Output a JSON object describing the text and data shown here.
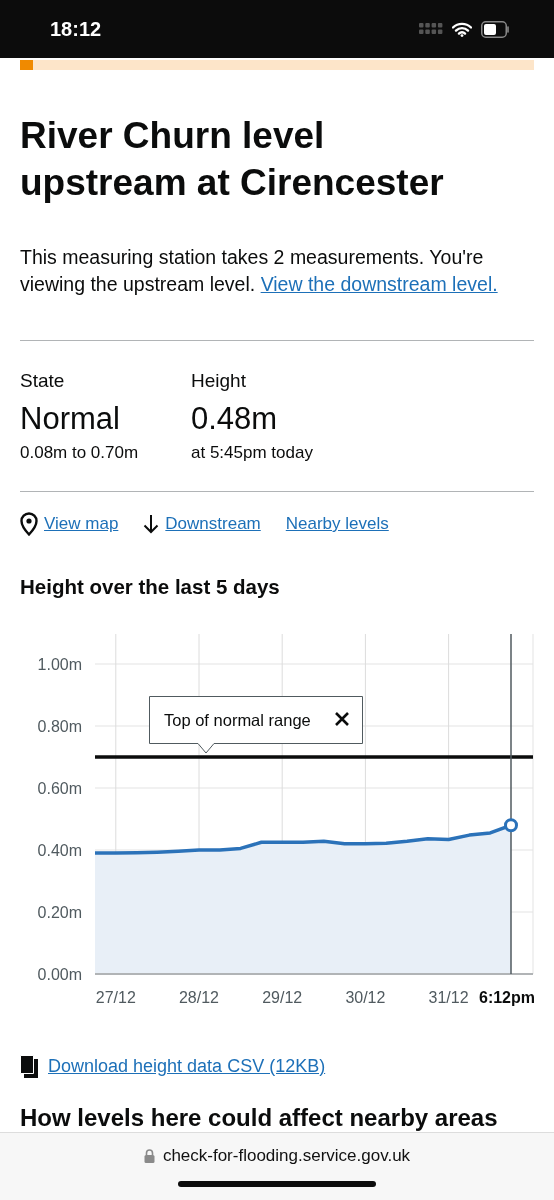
{
  "status_bar": {
    "time": "18:12"
  },
  "title": "River Churn level upstream at Cirencester",
  "intro": {
    "text": "This measuring station takes 2 measurements. You're viewing the upstream level.",
    "link": "View the downstream level."
  },
  "stats": [
    {
      "label": "State",
      "value": "Normal",
      "detail": "0.08m to 0.70m"
    },
    {
      "label": "Height",
      "value": "0.48m",
      "detail": "at 5:45pm today"
    }
  ],
  "links": [
    {
      "kind": "map",
      "label": "View map"
    },
    {
      "kind": "downstream",
      "label": "Downstream"
    },
    {
      "kind": "plain",
      "label": "Nearby levels"
    }
  ],
  "chart": {
    "title": "Height over the last 5 days",
    "chart_data": {
      "type": "area",
      "ylim": [
        0,
        1
      ],
      "categories": [
        null,
        "27/12",
        null,
        null,
        null,
        "28/12",
        null,
        null,
        null,
        "29/12",
        null,
        null,
        null,
        "30/12",
        null,
        null,
        null,
        "31/12",
        null,
        null,
        "6:12pm"
      ],
      "series": [
        {
          "color": "#2b72b9",
          "values": [
            0.39,
            0.39,
            0.391,
            0.393,
            0.396,
            0.4,
            0.4,
            0.405,
            0.425,
            0.425,
            0.425,
            0.428,
            0.42,
            0.42,
            0.422,
            0.428,
            0.436,
            0.434,
            0.448,
            0.455,
            0.48
          ]
        }
      ],
      "yticks": [
        {
          "value": 0,
          "label": "0.00m"
        },
        {
          "value": 0.2,
          "label": "0.20m"
        },
        {
          "value": 0.4,
          "label": "0.40m"
        },
        {
          "value": 0.6,
          "label": "0.60m"
        },
        {
          "value": 0.8,
          "label": "0.80m"
        },
        {
          "value": 1,
          "label": "1.00m"
        }
      ],
      "grid": true,
      "ref_lines": [
        {
          "axis": "y",
          "value": 0.7
        }
      ],
      "annotations": [
        "Top of normal range"
      ]
    }
  },
  "download": {
    "label": "Download height data CSV (12KB)"
  },
  "next_heading": "How levels here could affect nearby areas",
  "address_bar": {
    "url": "check-for-flooding.service.gov.uk"
  }
}
